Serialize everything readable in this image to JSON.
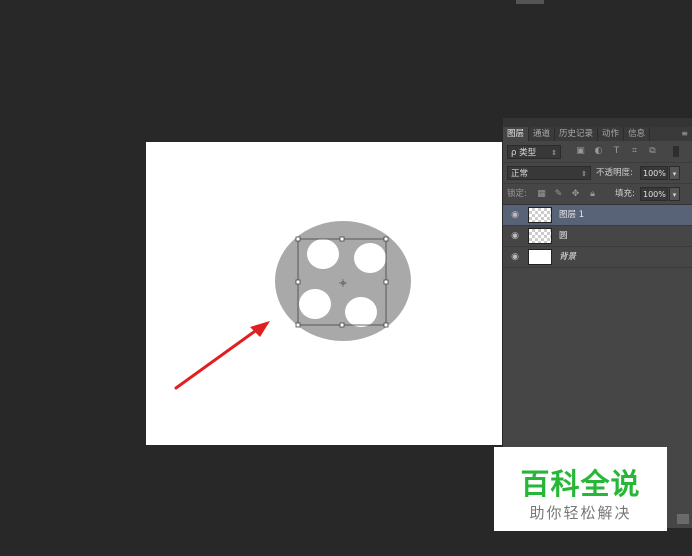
{
  "panel": {
    "tabs": [
      "图层",
      "通道",
      "历史记录",
      "动作",
      "信息"
    ],
    "active_tab": 0,
    "filter": {
      "kind_label": "ρ 类型"
    },
    "blend": {
      "mode": "正常",
      "opacity_label": "不透明度:",
      "opacity_value": "100%"
    },
    "lock": {
      "lock_label": "锁定:",
      "fill_label": "填充:",
      "fill_value": "100%"
    },
    "layers": [
      {
        "name": "图层 1",
        "selected": true,
        "thumb": "transparent"
      },
      {
        "name": "圆",
        "selected": false,
        "thumb": "transparent"
      },
      {
        "name": "背景",
        "selected": false,
        "thumb": "white"
      }
    ]
  },
  "watermark": {
    "title": "百科全说",
    "subtitle": "助你轻松解决",
    "title_color": "#27b737"
  },
  "colors": {
    "canvas_bg": "#ffffff",
    "circle": "#a9a9a9",
    "arrow": "#e02020",
    "selected_layer": "#596377",
    "workspace": "#282828"
  }
}
